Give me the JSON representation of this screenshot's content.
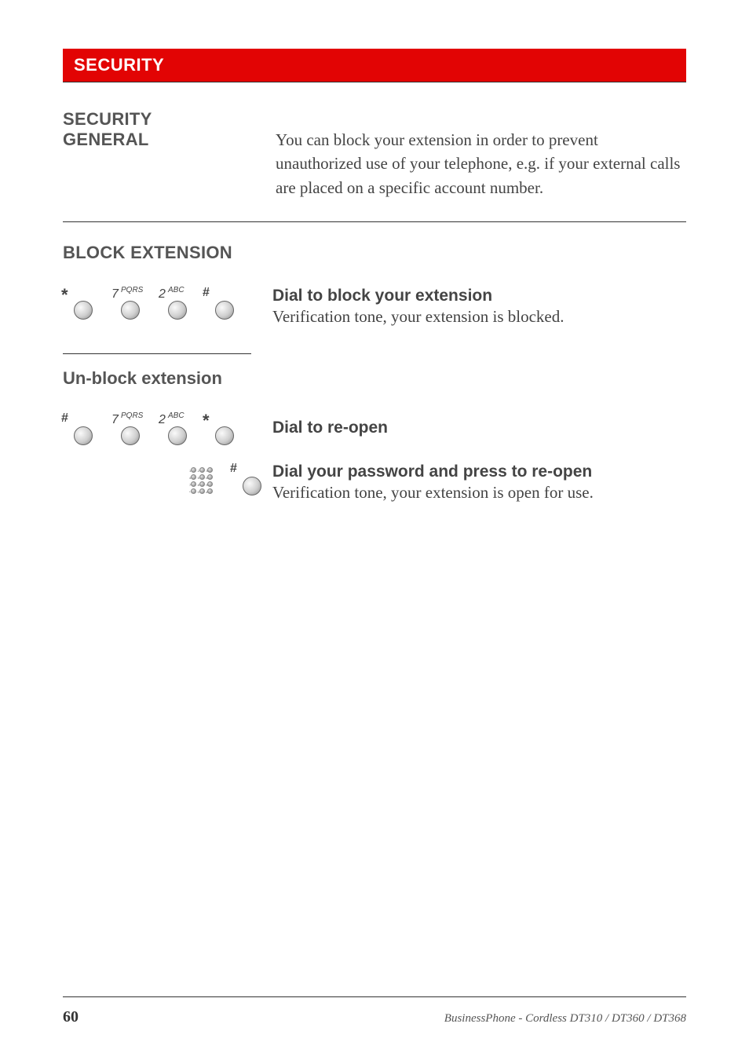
{
  "banner": "SECURITY",
  "intro": {
    "heading1": "SECURITY",
    "heading2": "GENERAL",
    "body": "You can block your extension in order to prevent unauthorized use of your telephone, e.g. if your external calls are placed on a specific account number."
  },
  "block": {
    "heading": "BLOCK EXTENSION",
    "keys": [
      "*",
      "7",
      "2",
      "#"
    ],
    "keyLetters": {
      "7": "PQRS",
      "2": "ABC"
    },
    "title": "Dial to block your extension",
    "body": "Verification tone, your extension is blocked."
  },
  "unblock": {
    "heading": "Un-block extension",
    "row1": {
      "keys": [
        "#",
        "7",
        "2",
        "*"
      ],
      "title": "Dial to re-open"
    },
    "row2": {
      "title": "Dial your password and press to re-open",
      "body": "Verification tone, your extension is open for use."
    }
  },
  "footer": {
    "page": "60",
    "text": "BusinessPhone - Cordless DT310 / DT360 / DT368"
  }
}
